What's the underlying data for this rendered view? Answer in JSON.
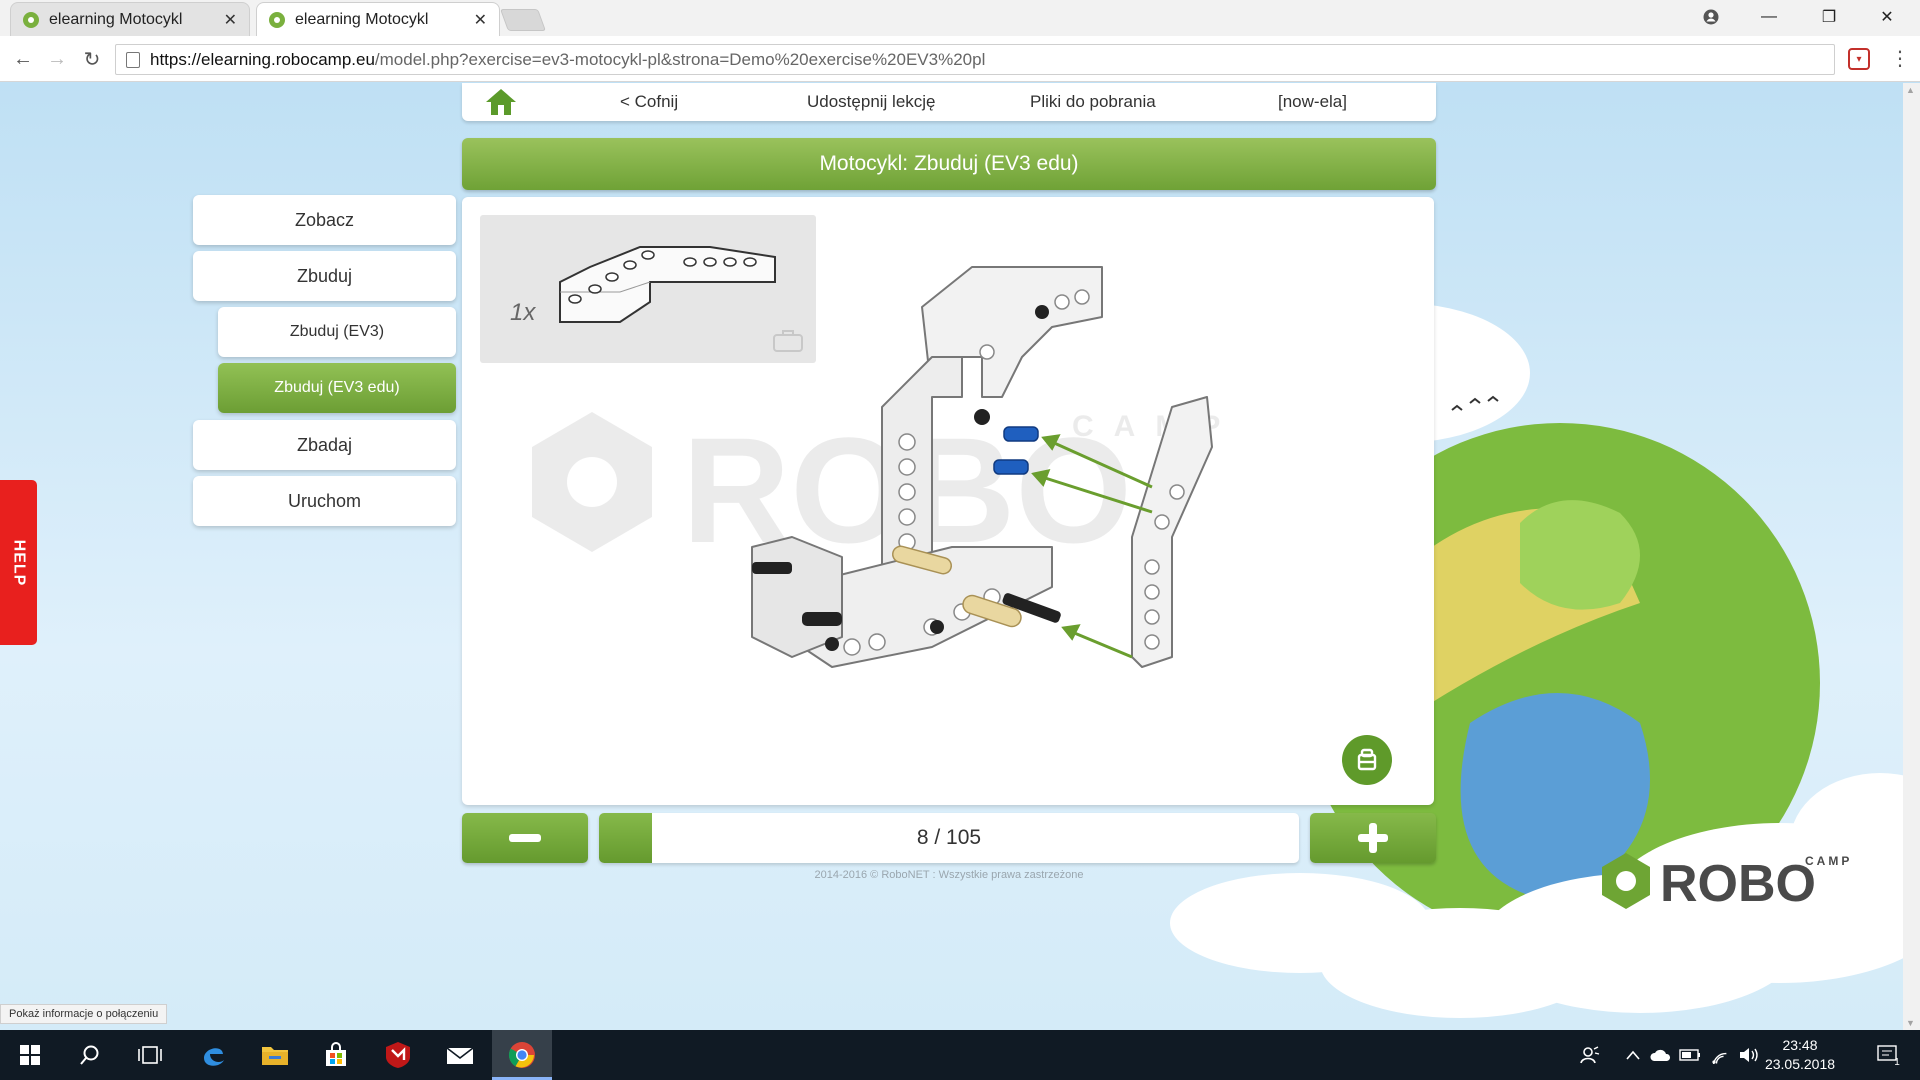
{
  "browser": {
    "tabs": [
      {
        "title": "elearning Motocykl",
        "active": false
      },
      {
        "title": "elearning Motocykl",
        "active": true
      }
    ],
    "url_host": "https://elearning.robocamp.eu",
    "url_path": "/model.php?exercise=ev3-motocykl-pl&strona=Demo%20exercise%20EV3%20pl",
    "status_hint": "Pokaż informacje o połączeniu"
  },
  "nav": {
    "back": "< Cofnij",
    "share": "Udostępnij lekcję",
    "downloads": "Pliki do pobrania",
    "user": "[now-ela]"
  },
  "page_title": "Motocykl: Zbuduj (EV3 edu)",
  "sidebar": {
    "items": [
      {
        "label": "Zobacz"
      },
      {
        "label": "Zbuduj"
      },
      {
        "label": "Zbuduj (EV3)"
      },
      {
        "label": "Zbuduj (EV3 edu)"
      },
      {
        "label": "Zbadaj"
      },
      {
        "label": "Uruchom"
      }
    ],
    "active": "Zbuduj (EV3 edu)"
  },
  "help_label": "HELP",
  "parts": {
    "quantity": "1x"
  },
  "watermark_text": "ROBO",
  "watermark_sub": "CAMP",
  "pager": {
    "current": 8,
    "total": 105,
    "text": "8 / 105",
    "progress_fraction": 0.076
  },
  "copyright": "2014-2016 © RoboNET : Wszystkie prawa zastrzeżone",
  "logo": {
    "text": "ROBO",
    "sub": "CAMP"
  },
  "taskbar": {
    "time": "23:48",
    "date": "23.05.2018",
    "notifications": "1"
  },
  "colors": {
    "brand_green": "#6fa236",
    "help_red": "#e8201e",
    "accent_blue": "#1f5fbf"
  }
}
